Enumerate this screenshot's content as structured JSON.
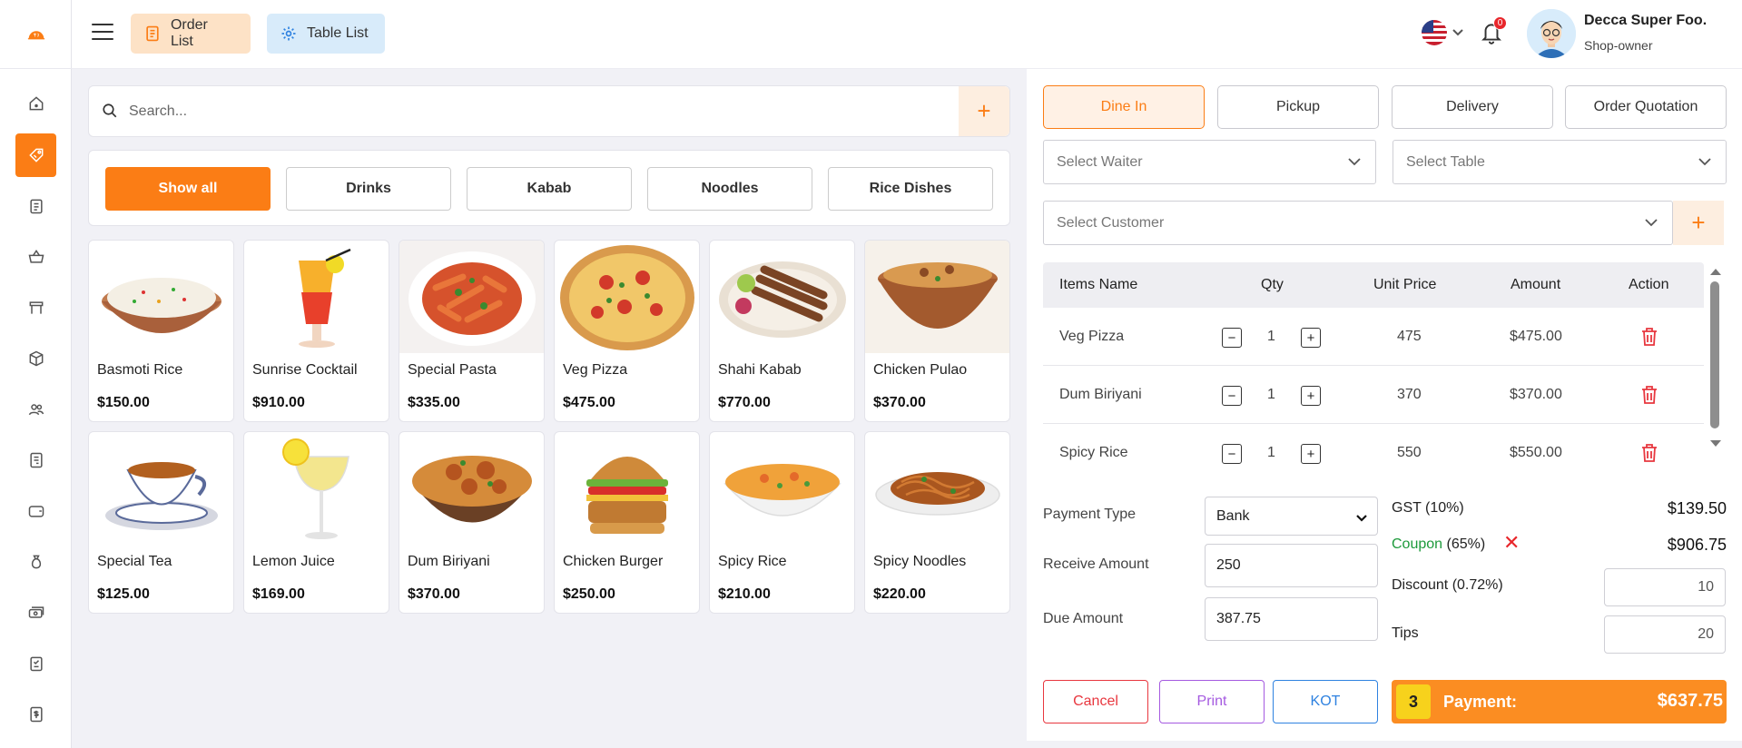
{
  "header": {
    "order_list_label": "Order List",
    "table_list_label": "Table List",
    "notification_count": "0",
    "user_name": "Decca Super Foo.",
    "user_role": "Shop-owner"
  },
  "search": {
    "placeholder": "Search..."
  },
  "categories": [
    "Show all",
    "Drinks",
    "Kabab",
    "Noodles",
    "Rice Dishes"
  ],
  "products": [
    {
      "name": "Basmoti Rice",
      "price": "$150.00"
    },
    {
      "name": "Sunrise Cocktail",
      "price": "$910.00"
    },
    {
      "name": "Special Pasta",
      "price": "$335.00"
    },
    {
      "name": "Veg Pizza",
      "price": "$475.00"
    },
    {
      "name": "Shahi Kabab",
      "price": "$770.00"
    },
    {
      "name": "Chicken Pulao",
      "price": "$370.00"
    },
    {
      "name": "Special Tea",
      "price": "$125.00"
    },
    {
      "name": "Lemon Juice",
      "price": "$169.00"
    },
    {
      "name": "Dum Biriyani",
      "price": "$370.00"
    },
    {
      "name": "Chicken Burger",
      "price": "$250.00"
    },
    {
      "name": "Spicy Rice",
      "price": "$210.00"
    },
    {
      "name": "Spicy Noodles",
      "price": "$220.00"
    }
  ],
  "order": {
    "tabs": [
      "Dine In",
      "Pickup",
      "Delivery",
      "Order Quotation"
    ],
    "waiter_placeholder": "Select Waiter",
    "table_placeholder": "Select Table",
    "customer_placeholder": "Select Customer",
    "columns": [
      "Items Name",
      "Qty",
      "Unit Price",
      "Amount",
      "Action"
    ],
    "items": [
      {
        "name": "Veg Pizza",
        "qty": "1",
        "unit_price": "475",
        "amount": "$475.00"
      },
      {
        "name": "Dum Biriyani",
        "qty": "1",
        "unit_price": "370",
        "amount": "$370.00"
      },
      {
        "name": "Spicy Rice",
        "qty": "1",
        "unit_price": "550",
        "amount": "$550.00"
      }
    ],
    "payment_type_label": "Payment Type",
    "payment_type_value": "Bank",
    "receive_amount_label": "Receive Amount",
    "receive_amount_value": "250",
    "due_amount_label": "Due Amount",
    "due_amount_value": "387.75",
    "gst_label": "GST (10%)",
    "gst_value": "$139.50",
    "coupon_label": "Coupon",
    "coupon_pct": " (65%)",
    "coupon_value": "$906.75",
    "discount_label": "Discount (0.72%)",
    "discount_value": "10",
    "tips_label": "Tips",
    "tips_value": "20",
    "cancel_label": "Cancel",
    "print_label": "Print",
    "kot_label": "KOT",
    "item_count": "3",
    "payment_label": "Payment:",
    "payment_total": "$637.75"
  },
  "colors": {
    "accent": "#fb7d15",
    "danger": "#e8373f",
    "coupon": "#1d9a3b"
  }
}
